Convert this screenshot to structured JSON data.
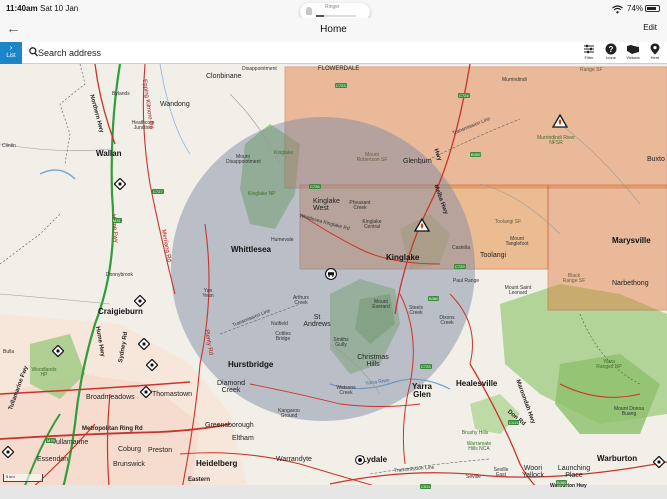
{
  "status_bar": {
    "time": "11:40am",
    "date": "Sat 10 Jan",
    "ringer_label": "Ringer",
    "battery": "74%"
  },
  "nav": {
    "title": "Home",
    "edit_label": "Edit"
  },
  "toolbar": {
    "list_label": "List",
    "search_placeholder": "Search address",
    "filter_label": "Filter",
    "icons_label": "Icons",
    "victoria_label": "Victoria",
    "here_label": "Here"
  },
  "map": {
    "scale_label": "5 km",
    "towns": {
      "clonbinane": "Clonbinane",
      "disappointment": "Disappointment",
      "flowerdale": "FLOWERDALE",
      "murrindindi": "Murrindindi",
      "range_sf": "Range SF",
      "bylands": "Bylands",
      "wandong": "Wandong",
      "heathcote_junction": "Heathcote Junction",
      "wallan": "Wallan",
      "clintin": "Clintin",
      "mount_disappointment": "Mount Disappointment",
      "kinglake_top": "Kinglake",
      "mount_robertson_sf": "Mount Robertson SF",
      "glenburn": "Glenburn",
      "murrindindi_river": "Murrindindi River NFSR",
      "buxton": "Buxto",
      "kinglake_west": "Kinglake West",
      "pheasant_creek": "Pheasant Creek",
      "kinglake_central": "Kinglake Central",
      "humevale": "Humevale",
      "castella": "Castella",
      "toolangi_sf": "Toolangi SF",
      "mount_tanglefoot": "Mount Tanglefoot",
      "marysville": "Marysville",
      "whittlesea": "Whittlesea",
      "kinglake": "Kinglake",
      "toolangi": "Toolangi",
      "narbethong": "Narbethong",
      "donnybrook": "Donnybrook",
      "black_range_sf": "Black Range SF",
      "yan_yean": "Yan Yean",
      "arthurs_creek": "Arthurs Creek",
      "mount_everard": "Mount Everard",
      "pauls_range": "Paul Range",
      "mount_saint_leonard": "Mount Saint Leonard",
      "craigieburn": "Craigieburn",
      "nutfield": "Nutfield",
      "st_andrews": "St Andrews",
      "steels_creek": "Steels Creek",
      "dixons_creek": "Dixons Creek",
      "cottles_bridge": "Cottles Bridge",
      "smiths_gully": "Smiths Gully",
      "christmas_hills": "Christmas Hills",
      "bulla": "Bulla",
      "woodlands": "Woodlands HP",
      "hurstbridge": "Hurstbridge",
      "yarra_ranges": "Yarra Ranges NP",
      "broadmeadows": "Broadmeadows",
      "thomastown": "Thomastown",
      "diamond_creek": "Diamond Creek",
      "healesville": "Healesville",
      "yarra_glen": "Yarra Glen",
      "kangaroo_ground": "Kangaroo Ground",
      "watsons_creek": "Watsons Creek",
      "tullamarine": "Tullamarine",
      "greensborough": "Greensborough",
      "mount_donna_buang": "Mount Donna Buang",
      "eltham": "Eltham",
      "coburg": "Coburg",
      "preston": "Preston",
      "essendon": "Essendon",
      "warrandyte": "Warrandyte",
      "heidelberg": "Heidelberg",
      "brunswick": "Brunswick",
      "lydale": "Lydale",
      "warburton": "Warburton",
      "woori_yallock": "Woori Yallock",
      "launching_place": "Launching Place",
      "seville_east": "Seville East",
      "seville": "Seville",
      "brushy": "Brushy Hills",
      "warramate": "Warramate Hills NCA",
      "kinglake_np": "Kinglake NP"
    },
    "roads": {
      "northern_hwy": "Northern Hwy",
      "hume_fwy": "Hume Fwy",
      "merriang_rd": "Merriang Rd",
      "plenty_rd": "Plenty Rd",
      "epping_kilmore_rd": "Epping Kilmore Rd",
      "melba_hwy": "Melba Hwy",
      "hume_hwy": "Hume Hwy",
      "sydney_rd": "Sydney Rd",
      "calder_fwy": "Tullamarine Fwy",
      "metropolitan_ring_rd": "Metropolitan Ring Rd",
      "transmission_line_1": "Transmission Line",
      "transmission_line_2": "Transmission Line",
      "transmission_line_3": "Transmission Line",
      "maroondah_hwy": "Maroondah Hwy",
      "warburton_hwy": "Warburton Hwy",
      "don_rd": "Don Rd",
      "eastern": "Eastern",
      "yarra_river": "Yarra River",
      "whittlesea_kinglake_rd": "Whittlesea Kinglake Rd",
      "hwy": "Hwy"
    },
    "shields": {
      "c723": "C723",
      "c724": "C724",
      "b300": "B300",
      "m31": "M31",
      "c727": "C727",
      "c726": "C726",
      "c729": "C729",
      "b360": "B360",
      "c725": "C725",
      "c411": "C411",
      "b380": "B380",
      "m79": "M79",
      "c511": "C511"
    },
    "colors": {
      "warning_zone": "#e07a3e",
      "warning_zone_border": "#c4451a",
      "radius_circle": "#7d8aa3",
      "park_green": "#8fbc6a",
      "road_red": "#c8342c",
      "freeway_green": "#2f9d3a"
    },
    "icons": [
      "fire-warning-icon",
      "fire-warning-icon",
      "diamond-incident-icon",
      "fire-truck-icon",
      "current-location-icon"
    ]
  }
}
